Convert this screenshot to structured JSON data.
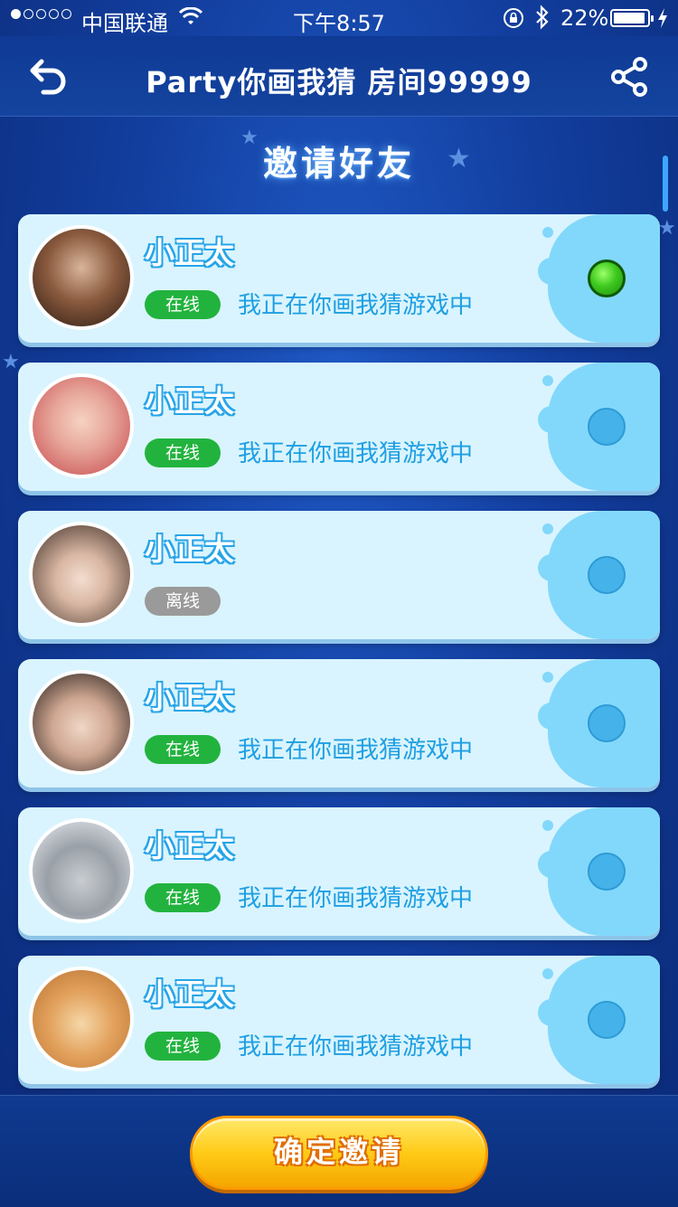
{
  "status_bar": {
    "carrier": "中国联通",
    "time": "下午8:57",
    "battery_percent": "22%",
    "battery_level": 0.22
  },
  "header": {
    "title": "Party你画我猜 房间99999",
    "back_icon": "back-arrow-icon",
    "share_icon": "share-icon"
  },
  "section": {
    "title": "邀请好友"
  },
  "friends": [
    {
      "name": "小正太",
      "status": "在线",
      "online": true,
      "activity": "我正在你画我猜游戏中",
      "selected": true
    },
    {
      "name": "小正太",
      "status": "在线",
      "online": true,
      "activity": "我正在你画我猜游戏中",
      "selected": false
    },
    {
      "name": "小正太",
      "status": "离线",
      "online": false,
      "activity": "",
      "selected": false
    },
    {
      "name": "小正太",
      "status": "在线",
      "online": true,
      "activity": "我正在你画我猜游戏中",
      "selected": false
    },
    {
      "name": "小正太",
      "status": "在线",
      "online": true,
      "activity": "我正在你画我猜游戏中",
      "selected": false
    },
    {
      "name": "小正太",
      "status": "在线",
      "online": true,
      "activity": "我正在你画我猜游戏中",
      "selected": false
    }
  ],
  "footer": {
    "confirm_label": "确定邀请"
  },
  "colors": {
    "online": "#22b33e",
    "offline": "#9a9a9a",
    "accent": "#1f9fe3",
    "button": "#ffcb17"
  }
}
